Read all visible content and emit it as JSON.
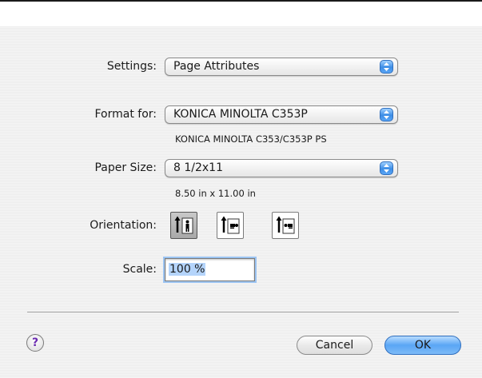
{
  "dialog": {
    "settings": {
      "label": "Settings:",
      "value": "Page Attributes"
    },
    "format_for": {
      "label": "Format for:",
      "value": "KONICA MINOLTA C353P",
      "subtext": "KONICA MINOLTA C353/C353P PS"
    },
    "paper_size": {
      "label": "Paper Size:",
      "value": "8 1/2x11",
      "subtext": "8.50 in x 11.00 in"
    },
    "orientation": {
      "label": "Orientation:",
      "options": [
        {
          "icon": "portrait-orientation-icon",
          "selected": true
        },
        {
          "icon": "landscape-orientation-icon",
          "selected": false
        },
        {
          "icon": "reverse-landscape-orientation-icon",
          "selected": false
        }
      ]
    },
    "scale": {
      "label": "Scale:",
      "value": "100 %"
    },
    "help": {
      "glyph": "?"
    },
    "buttons": {
      "cancel": "Cancel",
      "ok": "OK"
    }
  },
  "colors": {
    "accent": "#3c8de6",
    "help_glyph": "#6b2bb0",
    "sheet_bg": "#ececec"
  }
}
